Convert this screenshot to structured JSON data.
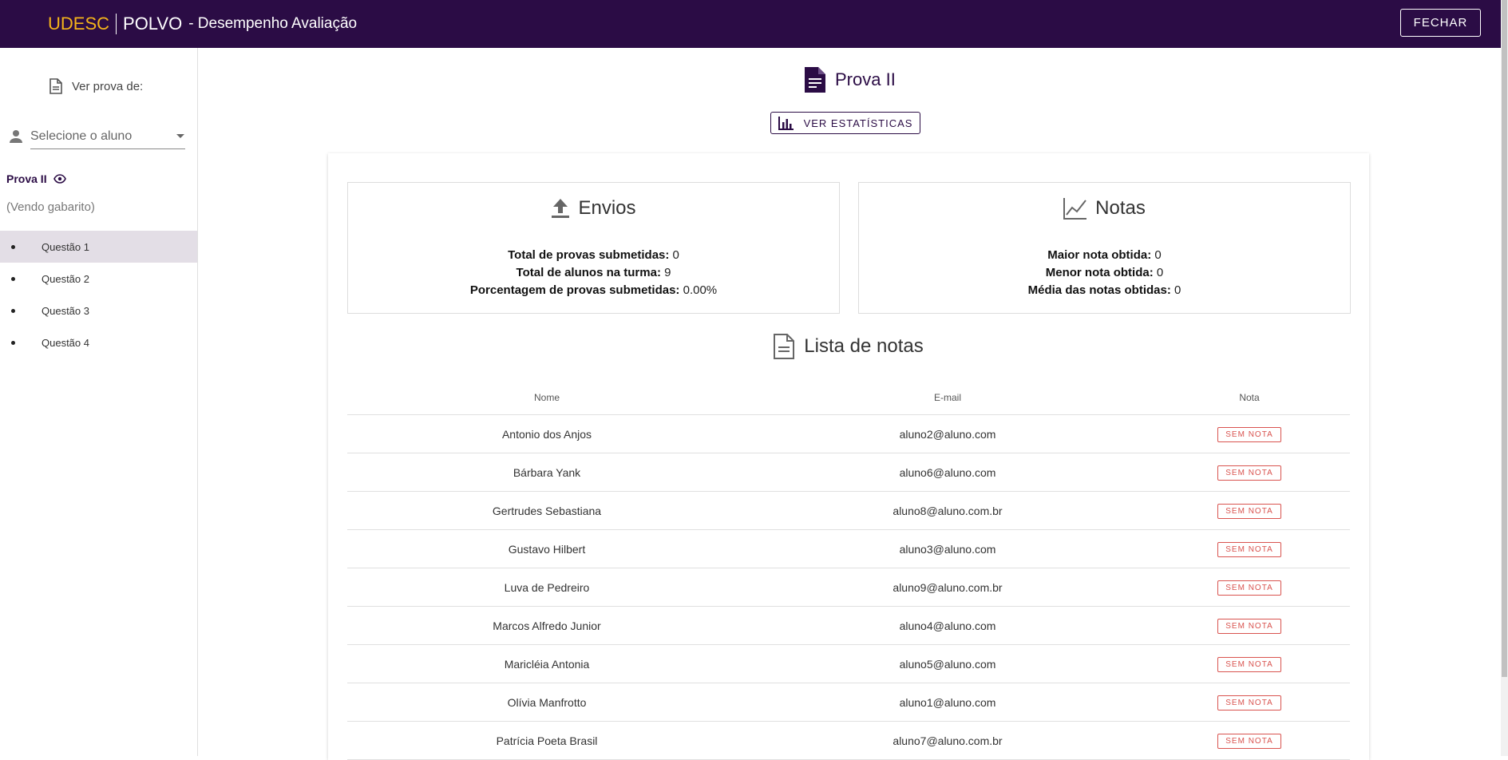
{
  "header": {
    "brand_udesc": "UDESC",
    "brand_polvo": "POLVO",
    "title": "- Desempenho Avaliação",
    "close_label": "FECHAR"
  },
  "sidebar": {
    "ver_prova_label": "Ver prova de:",
    "select_placeholder": "Selecione o aluno",
    "prova_name": "Prova II",
    "vendo_label": "(Vendo gabarito)",
    "questions": [
      {
        "label": "Questão 1",
        "active": true
      },
      {
        "label": "Questão 2",
        "active": false
      },
      {
        "label": "Questão 3",
        "active": false
      },
      {
        "label": "Questão 4",
        "active": false
      }
    ]
  },
  "main": {
    "title": "Prova II",
    "stats_button": "VER ESTATÍSTICAS",
    "envios": {
      "heading": "Envios",
      "lines": [
        {
          "label": "Total de provas submetidas:",
          "value": "0"
        },
        {
          "label": "Total de alunos na turma:",
          "value": "9"
        },
        {
          "label": "Porcentagem de provas submetidas:",
          "value": "0.00%"
        }
      ]
    },
    "notas": {
      "heading": "Notas",
      "lines": [
        {
          "label": "Maior nota obtida:",
          "value": "0"
        },
        {
          "label": "Menor nota obtida:",
          "value": "0"
        },
        {
          "label": "Média das notas obtidas:",
          "value": "0"
        }
      ]
    },
    "list_title": "Lista de notas",
    "table": {
      "headers": {
        "name": "Nome",
        "email": "E-mail",
        "nota": "Nota"
      },
      "rows": [
        {
          "name": "Antonio dos Anjos",
          "email": "aluno2@aluno.com",
          "nota": "SEM NOTA"
        },
        {
          "name": "Bárbara Yank",
          "email": "aluno6@aluno.com",
          "nota": "SEM NOTA"
        },
        {
          "name": "Gertrudes Sebastiana",
          "email": "aluno8@aluno.com.br",
          "nota": "SEM NOTA"
        },
        {
          "name": "Gustavo Hilbert",
          "email": "aluno3@aluno.com",
          "nota": "SEM NOTA"
        },
        {
          "name": "Luva de Pedreiro",
          "email": "aluno9@aluno.com.br",
          "nota": "SEM NOTA"
        },
        {
          "name": "Marcos Alfredo Junior",
          "email": "aluno4@aluno.com",
          "nota": "SEM NOTA"
        },
        {
          "name": "Maricléia Antonia",
          "email": "aluno5@aluno.com",
          "nota": "SEM NOTA"
        },
        {
          "name": "Olívia Manfrotto",
          "email": "aluno1@aluno.com",
          "nota": "SEM NOTA"
        },
        {
          "name": "Patrícia Poeta Brasil",
          "email": "aluno7@aluno.com.br",
          "nota": "SEM NOTA"
        }
      ]
    }
  },
  "colors": {
    "header_bg": "#2b0c45",
    "brand_accent": "#f5b41a",
    "badge_red": "#d9534f",
    "active_item_bg": "#e3dee6"
  }
}
